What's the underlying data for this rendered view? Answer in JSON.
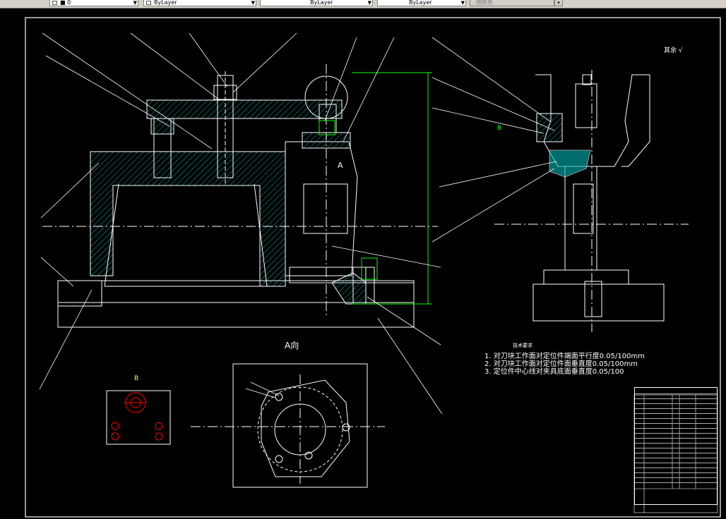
{
  "toolbar": {
    "layer_combo": "■ 0",
    "color_combo": "ByLayer",
    "linetype_combo": "ByLayer",
    "lineweight_combo": "ByLayer",
    "plotstyle_combo": "随颜色"
  },
  "drawing": {
    "section_label": "A",
    "view_a_label": "A向",
    "detail_b_label": "B",
    "detail_b_pointer": "B",
    "roughness_note": "其余 √",
    "tech_requirements_title": "技术要求",
    "tech_requirements": [
      "1.  对刀块工作面对定位件端面平行度0.05/100mm",
      "2.  对刀块工作面对定位件面垂直度0.05/100mm",
      "3.  定位件中心线对夹具底面垂直度0.05/100"
    ]
  },
  "colors": {
    "background": "#000000",
    "outline": "#ffffff",
    "hatch": "#00b4b4",
    "leader": "#ffffff",
    "dimension": "#00ff00",
    "hole_marker": "#ff0000"
  }
}
